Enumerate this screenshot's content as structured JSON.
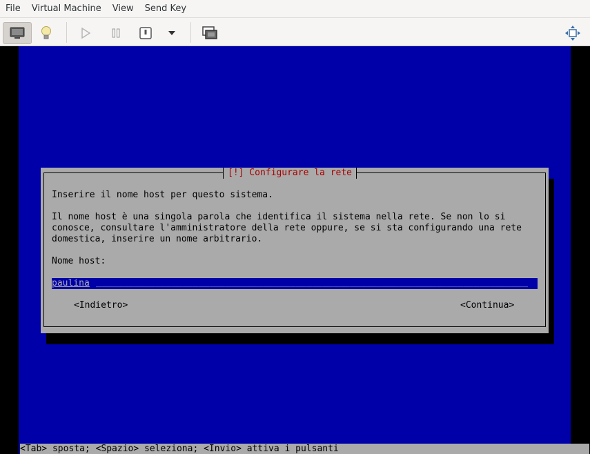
{
  "menubar": {
    "items": [
      "File",
      "Virtual Machine",
      "View",
      "Send Key"
    ]
  },
  "toolbar": {
    "buttons": [
      {
        "name": "console-view",
        "icon": "monitor-icon",
        "active": true
      },
      {
        "name": "details-view",
        "icon": "lightbulb-icon",
        "active": false
      },
      {
        "name": "run",
        "icon": "play-icon",
        "active": false
      },
      {
        "name": "pause",
        "icon": "pause-icon",
        "active": false
      },
      {
        "name": "shutdown",
        "icon": "power-icon",
        "active": false
      },
      {
        "name": "shutdown-menu",
        "icon": "chevron-down-icon",
        "active": false
      },
      {
        "name": "snapshots",
        "icon": "snapshots-icon",
        "active": false
      },
      {
        "name": "fullscreen",
        "icon": "fullscreen-icon",
        "active": false
      }
    ]
  },
  "installer": {
    "title": "[!] Configurare la rete",
    "prompt": "Inserire il nome host per questo sistema.",
    "description": [
      "Il nome host è una singola parola che identifica il sistema nella rete. Se non lo si",
      "conosce, consultare l'amministratore della rete oppure, se si sta configurando una rete",
      "domestica, inserire un nome arbitrario."
    ],
    "field_label": "Nome host:",
    "field_value": "paulina",
    "back_button": "<Indietro>",
    "continue_button": "<Continua>",
    "status_bar": "<Tab> sposta; <Spazio> seleziona; <Invio> attiva i pulsanti"
  },
  "colors": {
    "background_blue": "#0000a8",
    "dialog_gray": "#aaaaaa",
    "title_red": "#a80000"
  }
}
